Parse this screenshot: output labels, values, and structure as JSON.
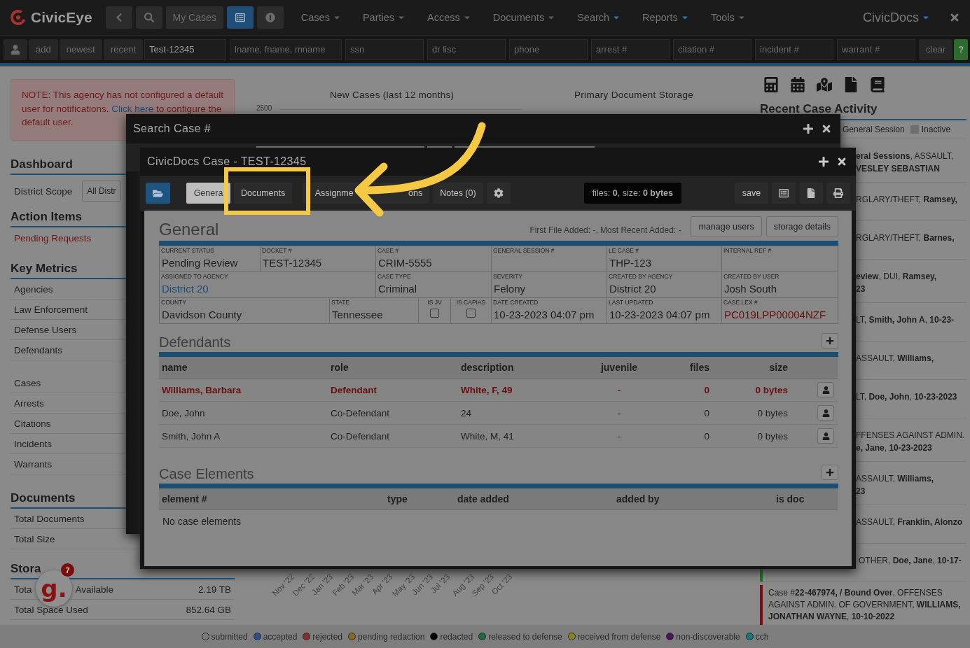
{
  "nav": {
    "logo": "CivicEye",
    "my_cases": "My Cases",
    "list_view": {
      "selected": true
    },
    "menus": [
      {
        "label": "Cases",
        "highlighted": false
      },
      {
        "label": "Parties",
        "highlighted": false
      },
      {
        "label": "Access",
        "highlighted": false
      },
      {
        "label": "Documents",
        "highlighted": false
      },
      {
        "label": "Search",
        "highlighted": true
      },
      {
        "label": "Reports",
        "highlighted": true
      },
      {
        "label": "Tools",
        "highlighted": false
      }
    ],
    "app_switch": {
      "label": "CivicDocs"
    }
  },
  "search_bar": {
    "buttons": [
      "add",
      "newest",
      "recent"
    ],
    "fields": [
      {
        "value": "Test-12345"
      },
      {
        "placeholder": "lname, fname, mname"
      },
      {
        "placeholder": "ssn"
      },
      {
        "placeholder": "dr lisc"
      },
      {
        "placeholder": "phone"
      },
      {
        "placeholder": "arrest #"
      },
      {
        "placeholder": "citation #"
      },
      {
        "placeholder": "incident #"
      },
      {
        "placeholder": "warrant #"
      }
    ],
    "clear": "clear",
    "help": "?"
  },
  "notice": {
    "before": "NOTE: This agency has not configured a default user for notifications. ",
    "link": "Click here",
    "after": " to configure the default user."
  },
  "dashboard": {
    "title": "Dashboard",
    "scope_label": "District Scope",
    "scope_value": "All Distr"
  },
  "action_items": {
    "title": "Action Items",
    "items": [
      "Pending Requests"
    ]
  },
  "key_metrics": {
    "title": "Key Metrics",
    "groups": [
      [
        "Agencies",
        "Law Enforcement",
        "Defense Users",
        "Defendants"
      ],
      [
        "Cases",
        "Arrests",
        "Citations",
        "Incidents",
        "Warrants"
      ]
    ]
  },
  "documents": {
    "title": "Documents",
    "items": [
      "Total Documents",
      "Total Size"
    ]
  },
  "storage": {
    "title": "Stora",
    "rows": [
      {
        "label": "Tota",
        "label_tail": "Available",
        "value": "2.19 TB"
      },
      {
        "label": "Total Space Used",
        "value": "852.64 GB"
      }
    ]
  },
  "charts": {
    "new_cases_title": "New Cases (last 12 months)",
    "ytick": "2500",
    "months": [
      "Nov '22",
      "Dec '22",
      "Jan '23",
      "Feb '23",
      "Mar '23",
      "Apr '23",
      "May '23",
      "Jun '23",
      "Jul '23",
      "Aug '23",
      "Sep '23",
      "Oct '23"
    ],
    "storage_title": "Primary Document Storage"
  },
  "recent": {
    "title": "Recent Case Activity",
    "legend": [
      {
        "label": "General Session"
      },
      {
        "label": "Inactive",
        "color": "#6e6e6e"
      }
    ],
    "items": [
      {
        "lines": [
          "**eral Sessions**, ASSAULT,",
          "**VESLEY SEBASTIAN**"
        ]
      },
      {
        "lines": [
          "RGLARY/THEFT, **Ramsey,**"
        ]
      },
      {
        "lines": [
          "RGLARY/THEFT, **Barnes,**"
        ]
      },
      {
        "lines": [
          "**eview**, DUI, **Ramsey,**",
          "**23**"
        ]
      },
      {
        "lines": [
          "LT, **Smith, John A**, **10-23-**"
        ]
      },
      {
        "lines": [
          "ASSAULT, **Williams,**"
        ]
      },
      {
        "lines": [
          "LT, **Doe, John**, **10-23-2023**"
        ]
      },
      {
        "lines": [
          "FFENSES AGAINST ADMIN.",
          "**e, Jane**, **10-23-2023**"
        ]
      },
      {
        "lines": [
          "ASSAULT, **Williams,**",
          "**23**"
        ]
      },
      {
        "lines": [
          "ASSAULT, **Franklin, Alonzo**"
        ]
      },
      {
        "lines": [
          "OTHER, **Doe, Jane**, **10-17-**"
        ],
        "color": "#137a13"
      },
      {
        "lines": [
          "Case #**22-467974, / Bound Over**, OFFENSES",
          "AGAINST ADMIN. OF GOVERNMENT, **WILLIAMS,**",
          "**JONATHAN WAYNE**, **10-10-2022**"
        ],
        "color": "#7e0e0e"
      }
    ]
  },
  "status_legend": [
    {
      "label": "submitted",
      "color": "#7b7b7b"
    },
    {
      "label": "accepted",
      "color": "#2d4f8e"
    },
    {
      "label": "rejected",
      "color": "#8a2d2d"
    },
    {
      "label": "pending redaction",
      "color": "#8a6a1f"
    },
    {
      "label": "redacted",
      "color": "#000000"
    },
    {
      "label": "released to defense",
      "color": "#1f6b3b"
    },
    {
      "label": "received from defense",
      "color": "#86861a"
    },
    {
      "label": "non-discoverable",
      "color": "#4b1060"
    },
    {
      "label": "cch",
      "color": "#137a7a"
    }
  ],
  "badge": {
    "letter": "g.",
    "count": "7"
  },
  "search_modal": {
    "title": "Search Case #"
  },
  "case_modal": {
    "title": "CivicDocs Case - TEST-12345",
    "tabs": [
      {
        "label": "Genera",
        "selected": true
      },
      {
        "label": "Documents",
        "selected": false
      },
      {
        "label": "Assignme",
        "selected": false
      },
      {
        "label": "ons",
        "selected": false
      },
      {
        "label": "Notes (0)",
        "selected": false
      }
    ],
    "file_info": "files: **0**, size: **0 bytes**",
    "save": "save",
    "general": {
      "title": "General",
      "added_info": "First File Added: -, Most Recent Added: -",
      "buttons": [
        "manage users",
        "storage details"
      ],
      "fields": [
        {
          "label": "CURRENT STATUS",
          "value": "Pending Review",
          "kind": "text"
        },
        {
          "label": "DOCKET #",
          "value": "TEST-12345",
          "kind": "text"
        },
        {
          "label": "CASE #",
          "value": "CRIM-5555",
          "kind": "text"
        },
        {
          "label": "GENERAL SESSION #",
          "kind": "text"
        },
        {
          "label": "LE CASE #",
          "value": "THP-123",
          "kind": "text"
        },
        {
          "label": "INTERNAL REF #",
          "kind": "text"
        },
        {
          "label": "ASSIGNED TO AGENCY",
          "value": "District 20",
          "kind": "link"
        },
        {
          "label": "CASE TYPE",
          "value": "Criminal",
          "kind": "text"
        },
        {
          "label": "SEVERITY",
          "value": "Felony",
          "kind": "text"
        },
        {
          "label": "CREATED BY AGENCY",
          "value": "District 20",
          "kind": "text"
        },
        {
          "label": "CREATED BY USER",
          "value": "Josh South",
          "kind": "text"
        },
        {
          "label": "COUNTY",
          "value": "Davidson County",
          "kind": "text"
        },
        {
          "label": "STATE",
          "value": "Tennessee",
          "kind": "text"
        },
        {
          "label": "IS JV",
          "checked": false,
          "kind": "checkbox"
        },
        {
          "label": "IS CAPIAS",
          "checked": false,
          "kind": "checkbox"
        },
        {
          "label": "DATE CREATED",
          "value": "10-23-2023 04:07 pm",
          "kind": "text"
        },
        {
          "label": "LAST UPDATED",
          "value": "10-23-2023 04:07 pm",
          "kind": "text"
        },
        {
          "label": "CASE LEX #",
          "value": "PC019LPP00004NZF",
          "kind": "lex"
        }
      ]
    },
    "defendants": {
      "title": "Defendants",
      "columns": [
        "name",
        "role",
        "description",
        "juvenile",
        "files",
        "size"
      ],
      "rows": [
        {
          "primary": true,
          "cells": [
            "Williams, Barbara",
            "Defendant",
            "White, F, 49",
            "-",
            "0",
            "0 bytes"
          ]
        },
        {
          "primary": false,
          "cells": [
            "Doe, John",
            "Co-Defendant",
            "24",
            "-",
            "0",
            "0 bytes"
          ]
        },
        {
          "primary": false,
          "cells": [
            "Smith, John A",
            "Co-Defendant",
            "White, M, 41",
            "-",
            "0",
            "0 bytes"
          ]
        }
      ]
    },
    "elements": {
      "title": "Case Elements",
      "columns": [
        "element #",
        "type",
        "date added",
        "added by",
        "is doc"
      ],
      "empty": "No case elements"
    }
  }
}
